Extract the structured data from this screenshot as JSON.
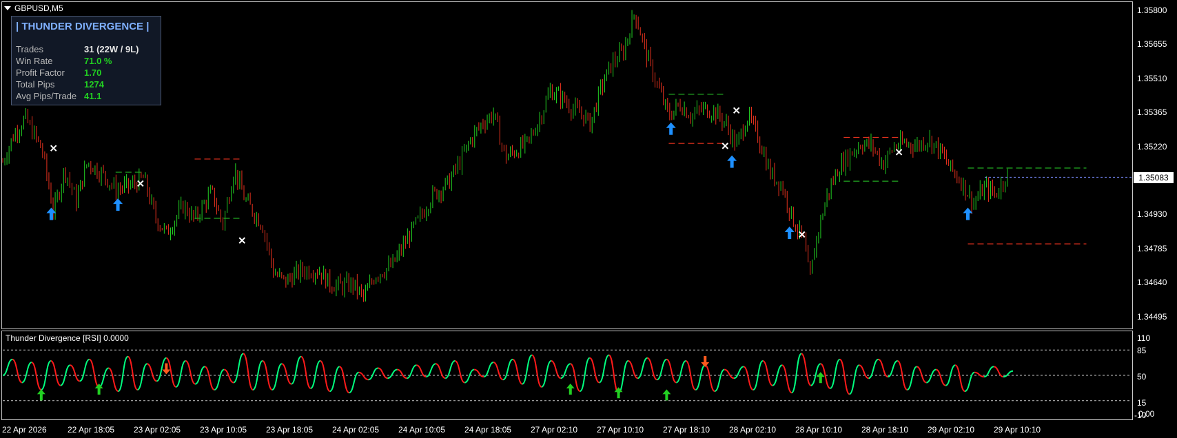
{
  "symbol": {
    "title": "GBPUSD,M5"
  },
  "stats_panel": {
    "title": "| THUNDER DIVERGENCE |",
    "rows": [
      {
        "label": "Trades",
        "value": "31  (22W / 9L)",
        "color": "#e6e6e6"
      },
      {
        "label": "Win Rate",
        "value": "71.0 %",
        "color": "#22d022"
      },
      {
        "label": "Profit Factor",
        "value": "1.70",
        "color": "#22d022"
      },
      {
        "label": "Total Pips",
        "value": "1274",
        "color": "#22d022"
      },
      {
        "label": "Avg Pips/Trade",
        "value": "41.1",
        "color": "#22d022"
      }
    ]
  },
  "price_axis": {
    "labels": [
      "1.35800",
      "1.35655",
      "1.35510",
      "1.35365",
      "1.35220",
      "1.35075",
      "1.34930",
      "1.34785",
      "1.34640",
      "1.34495"
    ],
    "current_price": "1.35083"
  },
  "indicator": {
    "title": "Thunder Divergence [RSI] 0.0000",
    "levels": [
      "110",
      "85",
      "50",
      "15",
      "-10"
    ],
    "extra_label": "0.00"
  },
  "time_axis": {
    "labels": [
      "22 Apr 2026",
      "22 Apr 18:05",
      "23 Apr 02:05",
      "23 Apr 10:05",
      "23 Apr 18:05",
      "24 Apr 02:05",
      "24 Apr 10:05",
      "24 Apr 18:05",
      "27 Apr 02:10",
      "27 Apr 10:10",
      "27 Apr 18:10",
      "28 Apr 02:10",
      "28 Apr 10:10",
      "28 Apr 18:10",
      "29 Apr 02:10",
      "29 Apr 10:10"
    ]
  },
  "colors": {
    "bull": "#22d022",
    "bear": "#e8321e",
    "buy_arrow": "#1e90ff",
    "sell_arrow": "#ff5a1e",
    "rsi_up": "#00ff7f",
    "rsi_down": "#ff1a1a",
    "grid": "#c8c8c8",
    "tp_line": "#22aa22",
    "sl_line": "#e8321e",
    "bid_line": "#7a8cff"
  },
  "chart_data": [
    {
      "type": "candlestick",
      "symbol": "GBPUSD",
      "timeframe": "M5",
      "ylim": [
        1.3443,
        1.3584
      ],
      "close_path": [
        [
          0,
          1.3515
        ],
        [
          0.01,
          1.3527
        ],
        [
          0.02,
          1.3534
        ],
        [
          0.035,
          1.352
        ],
        [
          0.045,
          1.3493
        ],
        [
          0.055,
          1.3512
        ],
        [
          0.065,
          1.3498
        ],
        [
          0.075,
          1.3515
        ],
        [
          0.09,
          1.3509
        ],
        [
          0.1,
          1.3503
        ],
        [
          0.115,
          1.3505
        ],
        [
          0.125,
          1.3508
        ],
        [
          0.135,
          1.3491
        ],
        [
          0.145,
          1.3484
        ],
        [
          0.16,
          1.3496
        ],
        [
          0.17,
          1.349
        ],
        [
          0.185,
          1.3502
        ],
        [
          0.195,
          1.3488
        ],
        [
          0.205,
          1.3512
        ],
        [
          0.215,
          1.3498
        ],
        [
          0.23,
          1.3488
        ],
        [
          0.24,
          1.3467
        ],
        [
          0.25,
          1.3463
        ],
        [
          0.265,
          1.3468
        ],
        [
          0.28,
          1.3468
        ],
        [
          0.29,
          1.3462
        ],
        [
          0.3,
          1.3461
        ],
        [
          0.31,
          1.3462
        ],
        [
          0.32,
          1.3456
        ],
        [
          0.33,
          1.3466
        ],
        [
          0.345,
          1.347
        ],
        [
          0.36,
          1.3483
        ],
        [
          0.37,
          1.3491
        ],
        [
          0.38,
          1.35
        ],
        [
          0.395,
          1.3506
        ],
        [
          0.405,
          1.3515
        ],
        [
          0.415,
          1.3525
        ],
        [
          0.425,
          1.3532
        ],
        [
          0.435,
          1.3536
        ],
        [
          0.445,
          1.3517
        ],
        [
          0.455,
          1.352
        ],
        [
          0.465,
          1.3523
        ],
        [
          0.475,
          1.3533
        ],
        [
          0.485,
          1.3546
        ],
        [
          0.495,
          1.3543
        ],
        [
          0.505,
          1.3538
        ],
        [
          0.515,
          1.3535
        ],
        [
          0.52,
          1.3531
        ],
        [
          0.53,
          1.3547
        ],
        [
          0.54,
          1.3558
        ],
        [
          0.55,
          1.3563
        ],
        [
          0.56,
          1.358
        ],
        [
          0.57,
          1.3562
        ],
        [
          0.58,
          1.3548
        ],
        [
          0.59,
          1.3535
        ],
        [
          0.6,
          1.354
        ],
        [
          0.61,
          1.3535
        ],
        [
          0.62,
          1.3538
        ],
        [
          0.63,
          1.3537
        ],
        [
          0.64,
          1.3532
        ],
        [
          0.65,
          1.3522
        ],
        [
          0.66,
          1.3535
        ],
        [
          0.67,
          1.3525
        ],
        [
          0.68,
          1.351
        ],
        [
          0.69,
          1.3505
        ],
        [
          0.7,
          1.349
        ],
        [
          0.71,
          1.348
        ],
        [
          0.715,
          1.3463
        ],
        [
          0.72,
          1.348
        ],
        [
          0.73,
          1.35
        ],
        [
          0.74,
          1.3512
        ],
        [
          0.75,
          1.3518
        ],
        [
          0.76,
          1.3523
        ],
        [
          0.77,
          1.3522
        ],
        [
          0.78,
          1.3514
        ],
        [
          0.79,
          1.3522
        ],
        [
          0.8,
          1.3523
        ],
        [
          0.81,
          1.3522
        ],
        [
          0.82,
          1.3525
        ],
        [
          0.83,
          1.352
        ],
        [
          0.84,
          1.3512
        ],
        [
          0.85,
          1.3506
        ],
        [
          0.86,
          1.3497
        ],
        [
          0.87,
          1.3504
        ],
        [
          0.88,
          1.3501
        ],
        [
          0.89,
          1.351
        ]
      ],
      "signals": [
        {
          "kind": "buy",
          "x": 0.043,
          "price": 1.34975
        },
        {
          "kind": "buy",
          "x": 0.102,
          "price": 1.35015
        },
        {
          "kind": "buy",
          "x": 0.592,
          "price": 1.35345
        },
        {
          "kind": "buy",
          "x": 0.646,
          "price": 1.35202
        },
        {
          "kind": "buy",
          "x": 0.697,
          "price": 1.34893
        },
        {
          "kind": "buy",
          "x": 0.855,
          "price": 1.34975
        }
      ],
      "exits": [
        {
          "x": 0.045,
          "price": 1.35209
        },
        {
          "x": 0.122,
          "price": 1.35056
        },
        {
          "x": 0.212,
          "price": 1.34809
        },
        {
          "x": 0.64,
          "price": 1.35219
        },
        {
          "x": 0.65,
          "price": 1.35373
        },
        {
          "x": 0.708,
          "price": 1.34835
        },
        {
          "x": 0.794,
          "price": 1.35192
        }
      ],
      "level_lines": [
        {
          "kind": "tp",
          "x1": 0.1,
          "x2": 0.125,
          "price": 1.35105
        },
        {
          "kind": "sl",
          "x1": 0.17,
          "x2": 0.21,
          "price": 1.35162
        },
        {
          "kind": "tp",
          "x1": 0.17,
          "x2": 0.21,
          "price": 1.34905
        },
        {
          "kind": "tp",
          "x1": 0.59,
          "x2": 0.64,
          "price": 1.35443
        },
        {
          "kind": "sl",
          "x1": 0.59,
          "x2": 0.64,
          "price": 1.3523
        },
        {
          "kind": "sl",
          "x1": 0.745,
          "x2": 0.795,
          "price": 1.35256
        },
        {
          "kind": "tp",
          "x1": 0.745,
          "x2": 0.795,
          "price": 1.35066
        },
        {
          "kind": "tp",
          "x1": 0.855,
          "x2": 0.96,
          "price": 1.35123
        },
        {
          "kind": "sl",
          "x1": 0.855,
          "x2": 0.96,
          "price": 1.34794
        }
      ],
      "bid_price": 1.35083
    },
    {
      "type": "line",
      "name": "Thunder Divergence [RSI]",
      "ylim": [
        -10,
        110
      ],
      "levels": [
        85,
        50,
        15
      ],
      "values": [
        50,
        72,
        40,
        68,
        30,
        70,
        36,
        64,
        42,
        72,
        34,
        60,
        28,
        76,
        30,
        66,
        42,
        74,
        34,
        70,
        38,
        62,
        30,
        58,
        40,
        80,
        30,
        70,
        30,
        66,
        38,
        76,
        32,
        70,
        28,
        62,
        26,
        54,
        44,
        60,
        46,
        58,
        46,
        64,
        48,
        66,
        46,
        70,
        40,
        58,
        48,
        68,
        44,
        72,
        38,
        78,
        34,
        70,
        46,
        66,
        28,
        74,
        40,
        78,
        26,
        70,
        46,
        74,
        44,
        72,
        40,
        70,
        30,
        64,
        28,
        58,
        46,
        62,
        30,
        70,
        36,
        64,
        26,
        80,
        36,
        66,
        32,
        72,
        24,
        64,
        46,
        72,
        48,
        70,
        30,
        62,
        40,
        58,
        36,
        64,
        28,
        54,
        48,
        62,
        48,
        56
      ],
      "signals": [
        {
          "kind": "buy",
          "index": 4,
          "level": 22
        },
        {
          "kind": "buy",
          "index": 10,
          "level": 30
        },
        {
          "kind": "sell",
          "index": 17,
          "level": 60
        },
        {
          "kind": "buy",
          "index": 59,
          "level": 30
        },
        {
          "kind": "buy",
          "index": 64,
          "level": 25
        },
        {
          "kind": "buy",
          "index": 69,
          "level": 22
        },
        {
          "kind": "sell",
          "index": 73,
          "level": 70
        },
        {
          "kind": "buy",
          "index": 85,
          "level": 46
        }
      ]
    }
  ]
}
